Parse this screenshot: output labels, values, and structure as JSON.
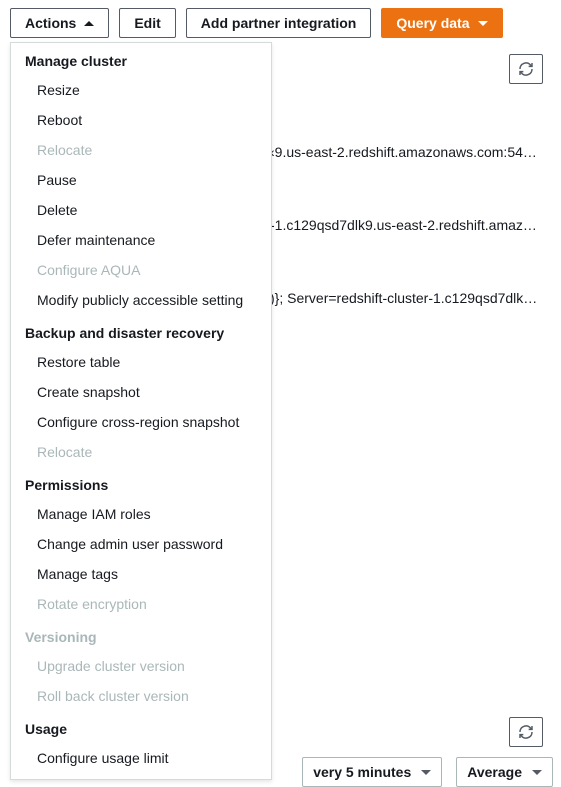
{
  "toolbar": {
    "actions_label": "Actions",
    "edit_label": "Edit",
    "add_partner_label": "Add partner integration",
    "query_data_label": "Query data"
  },
  "dropdown": {
    "sections": [
      {
        "title": "Manage cluster",
        "disabled": false,
        "items": [
          {
            "label": "Resize",
            "disabled": false
          },
          {
            "label": "Reboot",
            "disabled": false
          },
          {
            "label": "Relocate",
            "disabled": true
          },
          {
            "label": "Pause",
            "disabled": false
          },
          {
            "label": "Delete",
            "disabled": false
          },
          {
            "label": "Defer maintenance",
            "disabled": false
          },
          {
            "label": "Configure AQUA",
            "disabled": true
          },
          {
            "label": "Modify publicly accessible setting",
            "disabled": false
          }
        ]
      },
      {
        "title": "Backup and disaster recovery",
        "disabled": false,
        "items": [
          {
            "label": "Restore table",
            "disabled": false
          },
          {
            "label": "Create snapshot",
            "disabled": false
          },
          {
            "label": "Configure cross-region snapshot",
            "disabled": false
          },
          {
            "label": "Relocate",
            "disabled": true
          }
        ]
      },
      {
        "title": "Permissions",
        "disabled": false,
        "items": [
          {
            "label": "Manage IAM roles",
            "disabled": false
          },
          {
            "label": "Change admin user password",
            "disabled": false
          },
          {
            "label": "Manage tags",
            "disabled": false
          },
          {
            "label": "Rotate encryption",
            "disabled": true
          }
        ]
      },
      {
        "title": "Versioning",
        "disabled": true,
        "items": [
          {
            "label": "Upgrade cluster version",
            "disabled": true
          },
          {
            "label": "Roll back cluster version",
            "disabled": true
          }
        ]
      },
      {
        "title": "Usage",
        "disabled": false,
        "items": [
          {
            "label": "Configure usage limit",
            "disabled": false
          }
        ]
      }
    ]
  },
  "details": {
    "endpoint1": "‹9.us-east-2.redshift.amazonaws.com:54…",
    "endpoint2": "-1.c129qsd7dlk9.us-east-2.redshift.amaz…",
    "odbc": ")}; Server=redshift-cluster-1.c129qsd7dlk…"
  },
  "footer": {
    "interval_label": "very 5 minutes",
    "aggregate_label": "Average"
  }
}
